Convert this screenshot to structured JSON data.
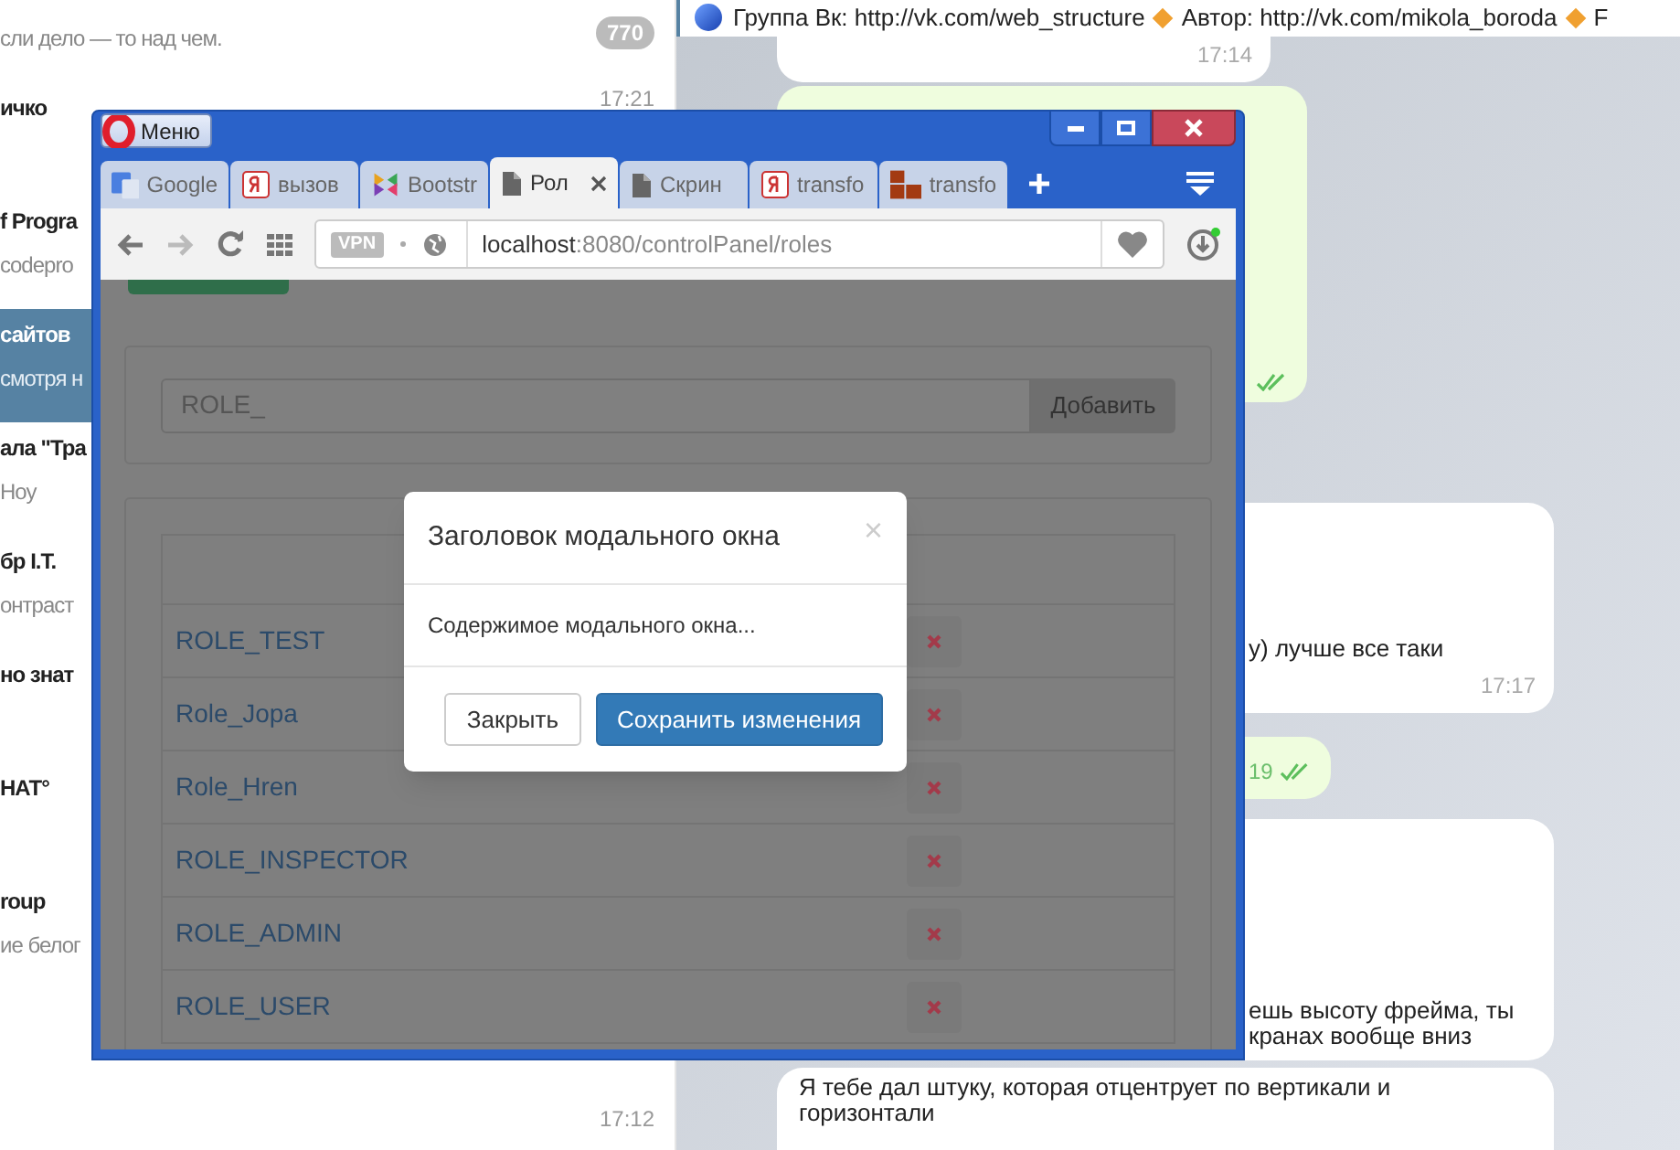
{
  "chat_list": {
    "items": [
      {
        "preview": "сли дело — то над чем.",
        "badge": "770",
        "selected": false
      },
      {
        "name": "ичко",
        "time": "17:21",
        "selected": false
      },
      {
        "name": "f Progra",
        "preview": "codepro",
        "selected": false
      },
      {
        "name": "сайтов",
        "preview": "смотря н",
        "selected": true
      },
      {
        "name": "ала \"Тра",
        "preview": "Ноу",
        "selected": false
      },
      {
        "name": "бр I.T.",
        "preview": "онтраст",
        "selected": false
      },
      {
        "name": "но знат",
        "selected": false
      },
      {
        "name": "НАТ°",
        "selected": false
      },
      {
        "name": "roup",
        "preview": "ие белог",
        "selected": false
      },
      {
        "time": "17:12",
        "selected": false
      }
    ]
  },
  "pinned_bar": {
    "parts": [
      "Группа Вк: http://vk.com/web_structure",
      "Автор: http://vk.com/mikola_boroda",
      "F"
    ]
  },
  "messages": [
    {
      "kind": "incoming",
      "time": "17:14"
    },
    {
      "kind": "outgoing",
      "read": true
    },
    {
      "kind": "incoming",
      "lines": [
        "у) лучше все таки"
      ],
      "time": "17:17"
    },
    {
      "kind": "outgoing",
      "time": "19",
      "read": true
    },
    {
      "kind": "incoming",
      "lines": [
        "ешь высоту фрейма, ты",
        "кранах вообще вниз"
      ]
    },
    {
      "kind": "incoming",
      "lines": [
        "Я тебе дал штуку, которая отцентрует по вертикали и",
        "горизонтали"
      ]
    }
  ],
  "browser": {
    "menu_label": "Меню",
    "tabs": [
      {
        "kind": "google",
        "label": "Google",
        "selected": false
      },
      {
        "kind": "yandex",
        "label": "вызов",
        "selected": false
      },
      {
        "kind": "bootstrap",
        "label": "Bootstr",
        "selected": false
      },
      {
        "kind": "page",
        "label": "Рол",
        "selected": true
      },
      {
        "kind": "page",
        "label": "Скрин",
        "selected": false
      },
      {
        "kind": "yandex",
        "label": "transfo",
        "selected": false
      },
      {
        "kind": "blocks",
        "label": "transfo",
        "selected": false
      }
    ],
    "vpn_badge": "VPN",
    "url_host": "localhost",
    "url_rest": ":8080/controlPanel/roles"
  },
  "page": {
    "role_input": {
      "value": "ROLE_"
    },
    "add_button": "Добавить",
    "roles": [
      "ROLE_TEST",
      "Role_Jopa",
      "Role_Hren",
      "ROLE_INSPECTOR",
      "ROLE_ADMIN",
      "ROLE_USER"
    ]
  },
  "modal": {
    "title": "Заголовок модального окна",
    "close": "×",
    "body": "Содержимое модального окна...",
    "buttons": [
      {
        "kind": "default",
        "label": "Закрыть"
      },
      {
        "kind": "primary",
        "label": "Сохранить изменения"
      }
    ]
  }
}
